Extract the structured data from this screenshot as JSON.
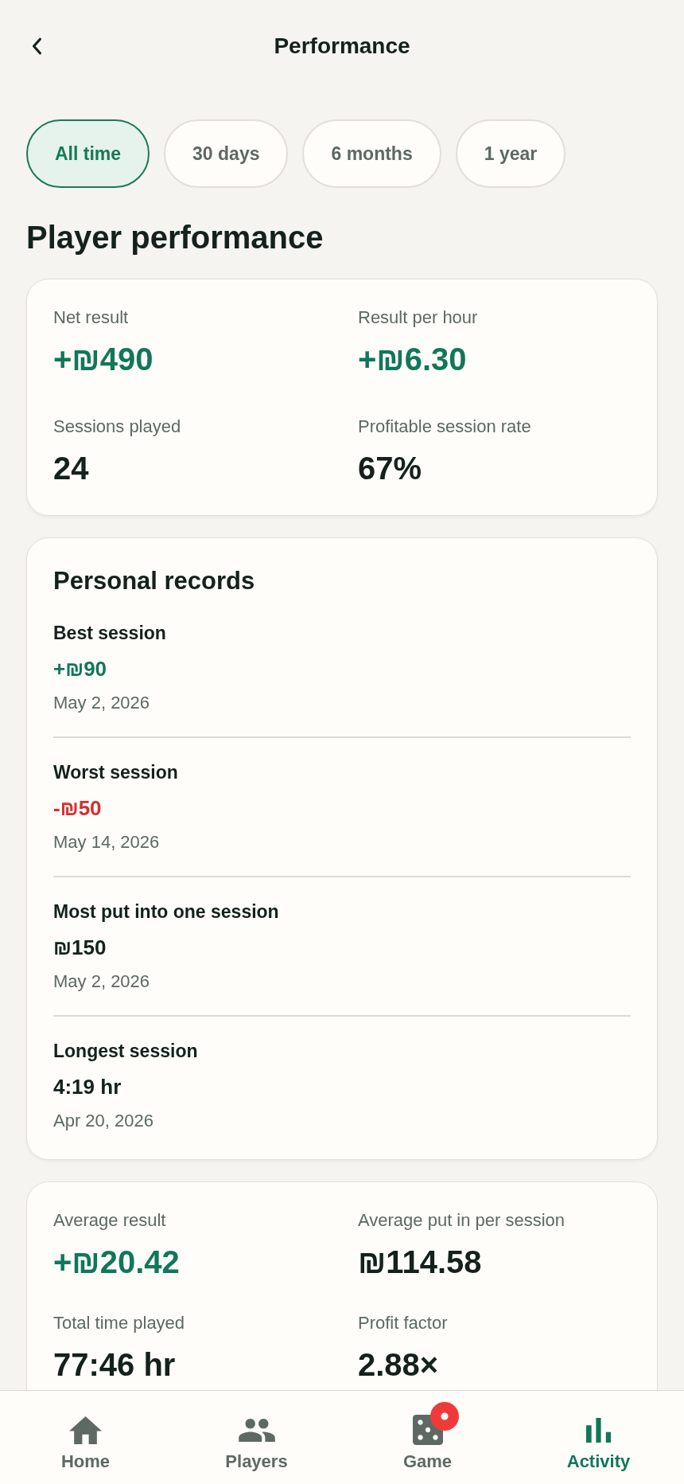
{
  "header": {
    "title": "Performance"
  },
  "filters": [
    {
      "label": "All time",
      "selected": true
    },
    {
      "label": "30 days",
      "selected": false
    },
    {
      "label": "6 months",
      "selected": false
    },
    {
      "label": "1 year",
      "selected": false
    }
  ],
  "section_title": "Player performance",
  "summary": {
    "stats": [
      {
        "label": "Net result",
        "value": "+₪490",
        "kind": "gain"
      },
      {
        "label": "Result per hour",
        "value": "+₪6.30",
        "kind": "gain"
      },
      {
        "label": "Sessions played",
        "value": "24",
        "kind": "plain"
      },
      {
        "label": "Profitable session rate",
        "value": "67%",
        "kind": "plain"
      }
    ]
  },
  "records": {
    "title": "Personal records",
    "items": [
      {
        "label": "Best session",
        "value": "+₪90",
        "kind": "gain",
        "date": "May 2, 2026"
      },
      {
        "label": "Worst session",
        "value": "-₪50",
        "kind": "loss",
        "date": "May 14, 2026"
      },
      {
        "label": "Most put into one session",
        "value": "₪150",
        "kind": "plain",
        "date": "May 2, 2026"
      },
      {
        "label": "Longest session",
        "value": "4:19 hr",
        "kind": "plain",
        "date": "Apr 20, 2026"
      }
    ]
  },
  "averages": {
    "stats": [
      {
        "label": "Average result",
        "value": "+₪20.42",
        "kind": "gain"
      },
      {
        "label": "Average put in per session",
        "value": "₪114.58",
        "kind": "plain"
      },
      {
        "label": "Total time played",
        "value": "77:46 hr",
        "kind": "plain"
      },
      {
        "label": "Profit factor",
        "value": "2.88×",
        "kind": "plain"
      }
    ]
  },
  "bottom_nav": [
    {
      "label": "Home",
      "selected": false,
      "badge": false
    },
    {
      "label": "Players",
      "selected": false,
      "badge": false
    },
    {
      "label": "Game",
      "selected": false,
      "badge": true
    },
    {
      "label": "Activity",
      "selected": true,
      "badge": false
    }
  ]
}
